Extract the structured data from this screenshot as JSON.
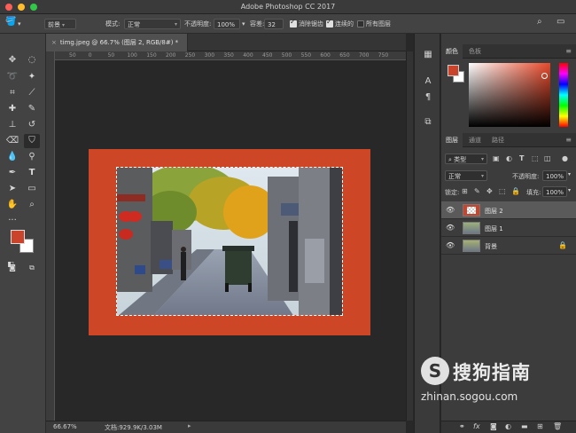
{
  "window": {
    "title": "Adobe Photoshop CC 2017"
  },
  "options_bar": {
    "preset": "前景",
    "mode_label": "模式:",
    "mode_value": "正常",
    "opacity_label": "不透明度:",
    "opacity_value": "100%",
    "tolerance_label": "容差:",
    "tolerance_value": "32",
    "antialias_label": "消除锯齿",
    "antialias_checked": true,
    "contiguous_label": "连续的",
    "contiguous_checked": true,
    "all_layers_label": "所有图层",
    "all_layers_checked": false
  },
  "document": {
    "tab_title": "timg.jpeg @ 66.7% (图层 2, RGB/8#) *",
    "ruler_ticks": [
      "50",
      "0",
      "50",
      "100",
      "150",
      "200",
      "250",
      "300",
      "350",
      "400",
      "450",
      "500",
      "550",
      "600",
      "650",
      "700",
      "750"
    ],
    "zoom": "66.67%",
    "doc_size": "文档:929.9K/3.03M"
  },
  "colors": {
    "foreground": "#c9442a",
    "background": "#ffffff",
    "artboard_fill": "#cd4726"
  },
  "color_panel": {
    "tabs": [
      "颜色",
      "色板"
    ]
  },
  "layers_panel": {
    "tabs": [
      "图层",
      "通道",
      "路径"
    ],
    "filter_kind": "类型",
    "blend_mode": "正常",
    "opacity_label": "不透明度:",
    "opacity_value": "100%",
    "lock_label": "锁定:",
    "fill_label": "填充:",
    "fill_value": "100%",
    "layers": [
      {
        "name": "图层 2",
        "selected": true,
        "locked": false
      },
      {
        "name": "图层 1",
        "selected": false,
        "locked": false
      },
      {
        "name": "背景",
        "selected": false,
        "locked": true
      }
    ]
  },
  "watermark": {
    "logo_letter": "S",
    "brand": "搜狗指南",
    "url": "zhinan.sogou.com"
  }
}
